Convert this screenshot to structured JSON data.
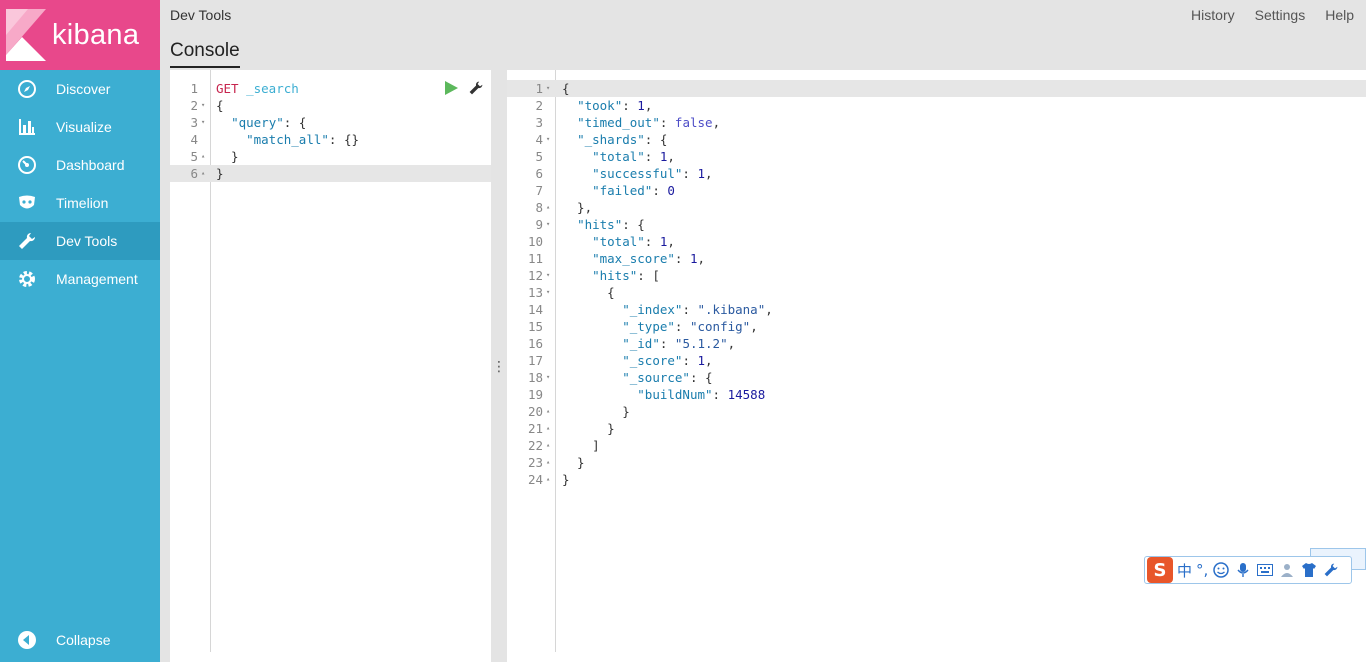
{
  "brand": {
    "logo_text": "kibana",
    "logo_color": "#e8488b",
    "sidebar_color": "#3caed2"
  },
  "sidebar": {
    "items": [
      {
        "label": "Discover",
        "icon": "compass-icon"
      },
      {
        "label": "Visualize",
        "icon": "bar-chart-icon"
      },
      {
        "label": "Dashboard",
        "icon": "gauge-icon"
      },
      {
        "label": "Timelion",
        "icon": "mask-icon"
      },
      {
        "label": "Dev Tools",
        "icon": "wrench-icon",
        "active": true
      },
      {
        "label": "Management",
        "icon": "gear-icon"
      }
    ],
    "collapse_label": "Collapse"
  },
  "header": {
    "app_title": "Dev Tools",
    "links": {
      "history": "History",
      "settings": "Settings",
      "help": "Help"
    },
    "tab": "Console"
  },
  "request_editor": {
    "lines": [
      {
        "n": "1",
        "fold": "",
        "text": "GET _search"
      },
      {
        "n": "2",
        "fold": "▾",
        "text": "{"
      },
      {
        "n": "3",
        "fold": "▾",
        "text": "  \"query\": {"
      },
      {
        "n": "4",
        "fold": "",
        "text": "    \"match_all\": {}"
      },
      {
        "n": "5",
        "fold": "▴",
        "text": "  }"
      },
      {
        "n": "6",
        "fold": "▴",
        "text": "}"
      }
    ]
  },
  "response_editor": {
    "lines": [
      {
        "n": "1",
        "fold": "▾",
        "text": "{"
      },
      {
        "n": "2",
        "fold": "",
        "text": "  \"took\": 1,"
      },
      {
        "n": "3",
        "fold": "",
        "text": "  \"timed_out\": false,"
      },
      {
        "n": "4",
        "fold": "▾",
        "text": "  \"_shards\": {"
      },
      {
        "n": "5",
        "fold": "",
        "text": "    \"total\": 1,"
      },
      {
        "n": "6",
        "fold": "",
        "text": "    \"successful\": 1,"
      },
      {
        "n": "7",
        "fold": "",
        "text": "    \"failed\": 0"
      },
      {
        "n": "8",
        "fold": "▴",
        "text": "  },"
      },
      {
        "n": "9",
        "fold": "▾",
        "text": "  \"hits\": {"
      },
      {
        "n": "10",
        "fold": "",
        "text": "    \"total\": 1,"
      },
      {
        "n": "11",
        "fold": "",
        "text": "    \"max_score\": 1,"
      },
      {
        "n": "12",
        "fold": "▾",
        "text": "    \"hits\": ["
      },
      {
        "n": "13",
        "fold": "▾",
        "text": "      {"
      },
      {
        "n": "14",
        "fold": "",
        "text": "        \"_index\": \".kibana\","
      },
      {
        "n": "15",
        "fold": "",
        "text": "        \"_type\": \"config\","
      },
      {
        "n": "16",
        "fold": "",
        "text": "        \"_id\": \"5.1.2\","
      },
      {
        "n": "17",
        "fold": "",
        "text": "        \"_score\": 1,"
      },
      {
        "n": "18",
        "fold": "▾",
        "text": "        \"_source\": {"
      },
      {
        "n": "19",
        "fold": "",
        "text": "          \"buildNum\": 14588"
      },
      {
        "n": "20",
        "fold": "▴",
        "text": "        }"
      },
      {
        "n": "21",
        "fold": "▴",
        "text": "      }"
      },
      {
        "n": "22",
        "fold": "▴",
        "text": "    ]"
      },
      {
        "n": "23",
        "fold": "▴",
        "text": "  }"
      },
      {
        "n": "24",
        "fold": "▴",
        "text": "}"
      }
    ]
  },
  "ime_toolbar": {
    "logo": "S",
    "mode_char": "中",
    "punct": "°,"
  }
}
